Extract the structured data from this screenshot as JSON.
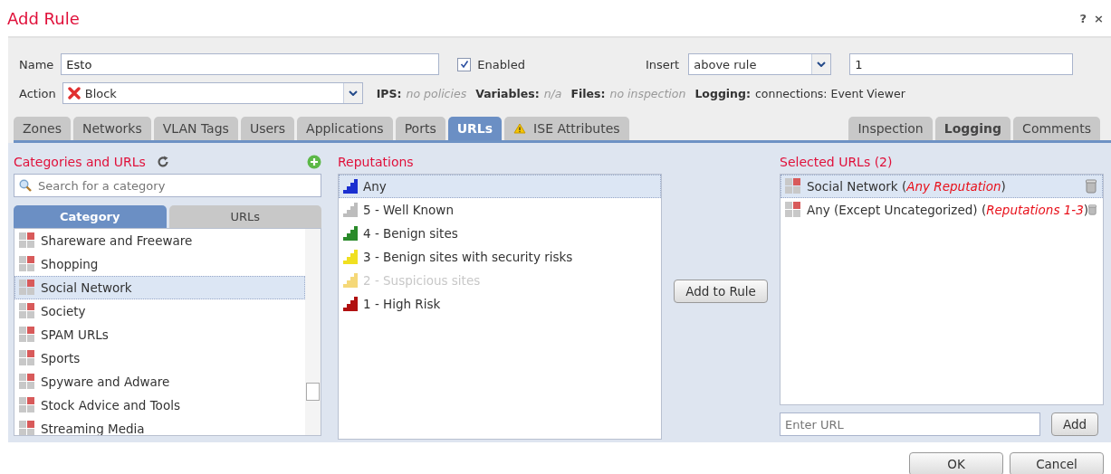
{
  "window": {
    "title": "Add Rule",
    "help": "?",
    "close": "×"
  },
  "form": {
    "name_label": "Name",
    "name_value": "Esto",
    "enabled_label": "Enabled",
    "enabled": true,
    "insert_label": "Insert",
    "insert_value": "above rule",
    "insert_number": "1",
    "action_label": "Action",
    "action_value": "Block"
  },
  "summary": [
    {
      "label": "IPS:",
      "value": "no policies",
      "muted": true
    },
    {
      "label": "Variables:",
      "value": "n/a",
      "muted": true
    },
    {
      "label": "Files:",
      "value": "no inspection",
      "muted": true
    },
    {
      "label": "Logging:",
      "value": "connections: Event Viewer",
      "muted": false
    }
  ],
  "tabs": [
    {
      "label": "Zones",
      "selected": false,
      "warning": false
    },
    {
      "label": "Networks",
      "selected": false,
      "warning": false
    },
    {
      "label": "VLAN Tags",
      "selected": false,
      "warning": false
    },
    {
      "label": "Users",
      "selected": false,
      "warning": false
    },
    {
      "label": "Applications",
      "selected": false,
      "warning": false
    },
    {
      "label": "Ports",
      "selected": false,
      "warning": false
    },
    {
      "label": "URLs",
      "selected": true,
      "warning": false
    },
    {
      "label": "ISE Attributes",
      "selected": false,
      "warning": true
    }
  ],
  "right_tabs": [
    {
      "label": "Inspection",
      "emphasized": false
    },
    {
      "label": "Logging",
      "emphasized": true
    },
    {
      "label": "Comments",
      "emphasized": false
    }
  ],
  "categories": {
    "title": "Categories and URLs",
    "search_placeholder": "Search for a category",
    "subtabs": [
      {
        "label": "Category",
        "selected": true
      },
      {
        "label": "URLs",
        "selected": false
      }
    ],
    "items": [
      {
        "label": "Shareware and Freeware",
        "selected": false
      },
      {
        "label": "Shopping",
        "selected": false
      },
      {
        "label": "Social Network",
        "selected": true
      },
      {
        "label": "Society",
        "selected": false
      },
      {
        "label": "SPAM URLs",
        "selected": false
      },
      {
        "label": "Sports",
        "selected": false
      },
      {
        "label": "Spyware and Adware",
        "selected": false
      },
      {
        "label": "Stock Advice and Tools",
        "selected": false
      },
      {
        "label": "Streaming Media",
        "selected": false
      }
    ]
  },
  "reputations": {
    "title": "Reputations",
    "items": [
      {
        "label": "Any",
        "selected": true,
        "disabled": false,
        "color": "#1a2fd0"
      },
      {
        "label": "5 - Well Known",
        "selected": false,
        "disabled": false,
        "color": "#bdbdbd"
      },
      {
        "label": "4 - Benign sites",
        "selected": false,
        "disabled": false,
        "color": "#2a8a2a"
      },
      {
        "label": "3 - Benign sites with security risks",
        "selected": false,
        "disabled": false,
        "color": "#f0e020"
      },
      {
        "label": "2 - Suspicious sites",
        "selected": false,
        "disabled": true,
        "color": "#f5d878"
      },
      {
        "label": "1 - High Risk",
        "selected": false,
        "disabled": false,
        "color": "#b01010"
      }
    ]
  },
  "add_to_rule": "Add to Rule",
  "selected_urls": {
    "title": "Selected URLs (2)",
    "items": [
      {
        "text": "Social Network (*Any Reputation*)",
        "selected": true
      },
      {
        "text": "Any (Except Uncategorized) (*Reputations 1-3*)",
        "selected": false
      }
    ],
    "url_placeholder": "Enter URL",
    "add": "Add"
  },
  "buttons": [
    "OK",
    "Cancel"
  ]
}
